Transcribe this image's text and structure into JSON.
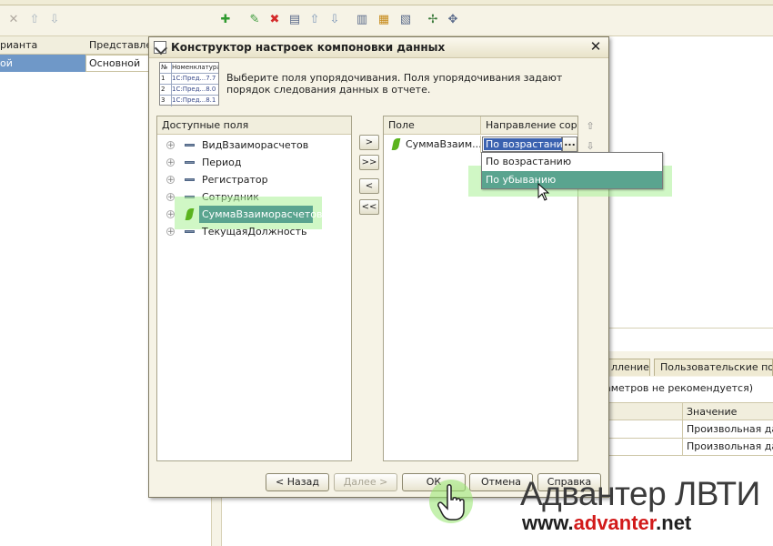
{
  "background": {
    "grid_headers": [
      "рианта",
      "Представлен"
    ],
    "selected_row": [
      "ой",
      "Основной"
    ],
    "lower_tabs": [
      "лление",
      "Пользовательские поля"
    ],
    "lower_note": "аметров не рекомендуется)",
    "value_header": "Значение",
    "value_rows": [
      "Произвольная дата",
      "Произвольная дата"
    ]
  },
  "dialog": {
    "title": "Конструктор настроек компоновки данных",
    "hint": "Выберите поля упорядочивания. Поля упорядочивания задают порядок следования данных в отчете.",
    "thumbnail": {
      "header": [
        "№",
        "Номенклатура"
      ],
      "rows": [
        [
          "1",
          "1С:Пред...7.7"
        ],
        [
          "2",
          "1С:Пред...8.0"
        ],
        [
          "3",
          "1С:Пред...8.1"
        ]
      ]
    },
    "available_panel": {
      "title": "Доступные поля",
      "items": [
        {
          "label": "ВидВзаиморасчетов",
          "icon": "field-dash-icon"
        },
        {
          "label": "Период",
          "icon": "field-dash-icon"
        },
        {
          "label": "Регистратор",
          "icon": "field-dash-icon"
        },
        {
          "label": "Сотрудник",
          "icon": "field-dash-icon"
        },
        {
          "label": "СуммаВзаиморасчетов",
          "icon": "resource-leaf-icon"
        },
        {
          "label": "ТекущаяДолжность",
          "icon": "field-dash-icon"
        }
      ]
    },
    "move_buttons": [
      ">",
      ">>",
      "<",
      "<<"
    ],
    "order_panel": {
      "col_field": "Поле",
      "col_direction": "Направление сор...",
      "row_field": "СуммаВзаим...",
      "row_direction": "По возрастанию",
      "ellipsis": "..."
    },
    "dropdown_options": [
      "По возрастанию",
      "По убыванию"
    ],
    "buttons": {
      "back": "< Назад",
      "next": "Далее >",
      "ok": "ОК",
      "cancel": "Отмена",
      "help": "Справка"
    }
  },
  "watermark": {
    "line1": "Адвантер ЛВТИ",
    "line2_prefix": "www.",
    "line2_brand": "advanter",
    "line2_suffix": ".net"
  },
  "colors": {
    "selection_teal": "#5aa48f",
    "highlight_green": "#aaf096",
    "brand_red": "#d21a1a"
  }
}
